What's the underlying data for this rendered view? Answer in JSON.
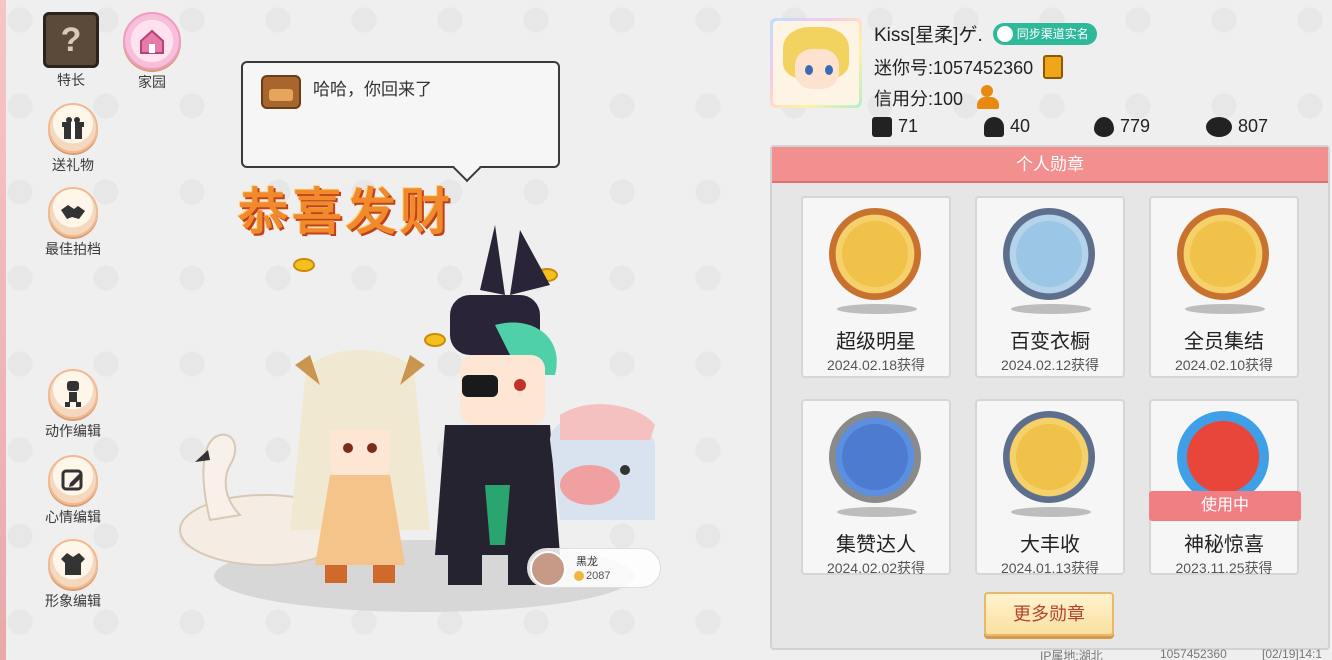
{
  "left_menu": {
    "talent": "特长",
    "home": "家园",
    "gift": "送礼物",
    "best_photo": "最佳拍档",
    "action_edit": "动作编辑",
    "mood_edit": "心情编辑",
    "look_edit": "形象编辑"
  },
  "speech": {
    "text": "哈哈，你回来了"
  },
  "congrats": "恭喜发财",
  "pet": {
    "name": "黑龙",
    "value": "2087"
  },
  "profile": {
    "name": "Kiss[星柔]ゲ.",
    "verify_badge": "同步渠道实名",
    "mini_id": "迷你号:1057452360",
    "credit": "信用分:100"
  },
  "stats": {
    "friends": "71",
    "fans": "40",
    "hot": "779",
    "likes": "807"
  },
  "medals": {
    "title": "个人勋章",
    "in_use": "使用中",
    "more": "更多勋章",
    "items": [
      {
        "name": "超级明星",
        "date": "2024.02.18获得",
        "color": "#f0c24a"
      },
      {
        "name": "百变衣橱",
        "date": "2024.02.12获得",
        "color": "#9bc6e6"
      },
      {
        "name": "全员集结",
        "date": "2024.02.10获得",
        "color": "#f0c24a"
      },
      {
        "name": "集赞达人",
        "date": "2024.02.02获得",
        "color": "#4c7bd0"
      },
      {
        "name": "大丰收",
        "date": "2024.01.13获得",
        "color": "#f0c24a"
      },
      {
        "name": "神秘惊喜",
        "date": "2023.11.25获得",
        "color": "#e8463a"
      }
    ]
  },
  "footer": {
    "ip": "IP属地:湖北",
    "id": "1057452360",
    "date": "[02/19]14:1"
  }
}
